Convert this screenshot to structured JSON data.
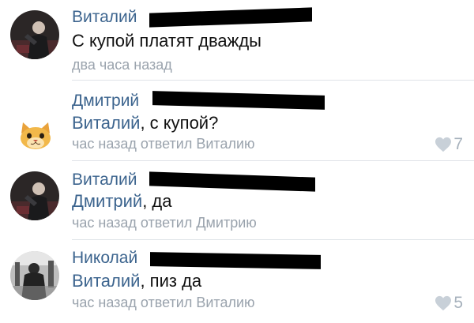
{
  "comments": [
    {
      "author": "Виталий",
      "mention": "",
      "text": "С купой платят дважды",
      "meta": "два часа назад",
      "likes": "",
      "avatar_icon": "user-photo-dark"
    },
    {
      "author": "Дмитрий",
      "mention": "Виталий",
      "text": ", с купой?",
      "meta": "час назад ответил Виталию",
      "likes": "7",
      "avatar_icon": "cat-sticker"
    },
    {
      "author": "Виталий",
      "mention": "Дмитрий",
      "text": ", да",
      "meta": "час назад ответил Дмитрию",
      "likes": "",
      "avatar_icon": "user-photo-dark"
    },
    {
      "author": "Николай",
      "mention": "Виталий",
      "text": ", пиз да",
      "meta": "час назад ответил Виталию",
      "likes": "5",
      "avatar_icon": "user-photo-grayscale"
    }
  ],
  "colors": {
    "author": "#3c648e",
    "text": "#111111",
    "meta": "#9aa3ad",
    "like": "#a6b1bc",
    "separator": "#dfe3e8",
    "redaction": "#000000"
  },
  "like_icon": "heart-icon"
}
